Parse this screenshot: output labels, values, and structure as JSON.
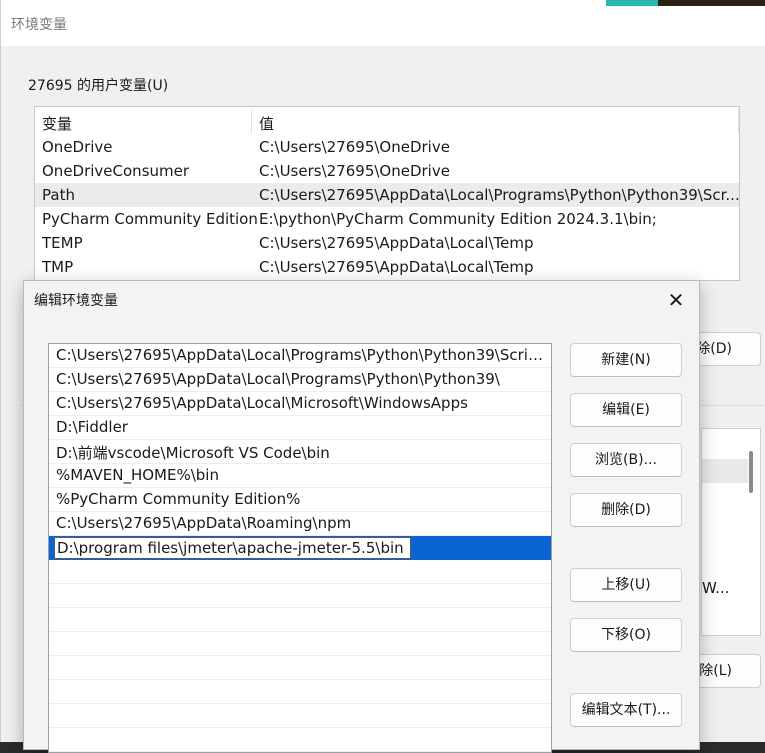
{
  "background": {
    "window_title": "环境变量",
    "user_vars_group_label": "27695 的用户变量(U)",
    "columns": [
      "变量",
      "值"
    ],
    "user_vars": [
      {
        "name": "OneDrive",
        "value": "C:\\Users\\27695\\OneDrive",
        "selected": false
      },
      {
        "name": "OneDriveConsumer",
        "value": "C:\\Users\\27695\\OneDrive",
        "selected": false
      },
      {
        "name": "Path",
        "value": "C:\\Users\\27695\\AppData\\Local\\Programs\\Python\\Python39\\Scr...",
        "selected": true
      },
      {
        "name": "PyCharm Community Edition",
        "value": "E:\\python\\PyCharm Community Edition 2024.3.1\\bin;",
        "selected": false
      },
      {
        "name": "TEMP",
        "value": "C:\\Users\\27695\\AppData\\Local\\Temp",
        "selected": false
      },
      {
        "name": "TMP",
        "value": "C:\\Users\\27695\\AppData\\Local\\Temp",
        "selected": false
      }
    ],
    "user_delete_button_partial": "除(D)",
    "system_delete_button_partial": "除(L)",
    "system_list_partial_text": "W..."
  },
  "dialog": {
    "title": "编辑环境变量",
    "close_glyph": "✕",
    "paths": [
      "C:\\Users\\27695\\AppData\\Local\\Programs\\Python\\Python39\\Scrip...",
      "C:\\Users\\27695\\AppData\\Local\\Programs\\Python\\Python39\\",
      "C:\\Users\\27695\\AppData\\Local\\Microsoft\\WindowsApps",
      "D:\\Fiddler",
      "D:\\前端vscode\\Microsoft VS Code\\bin",
      "%MAVEN_HOME%\\bin",
      "%PyCharm Community Edition%",
      "C:\\Users\\27695\\AppData\\Roaming\\npm"
    ],
    "editing_value": "D:\\program files\\jmeter\\apache-jmeter-5.5\\bin",
    "buttons": {
      "new": "新建(N)",
      "edit": "编辑(E)",
      "browse": "浏览(B)...",
      "delete": "删除(D)",
      "move_up": "上移(U)",
      "move_down": "下移(O)",
      "edit_text": "编辑文本(T)..."
    },
    "selection_color": "#0a64d3"
  }
}
